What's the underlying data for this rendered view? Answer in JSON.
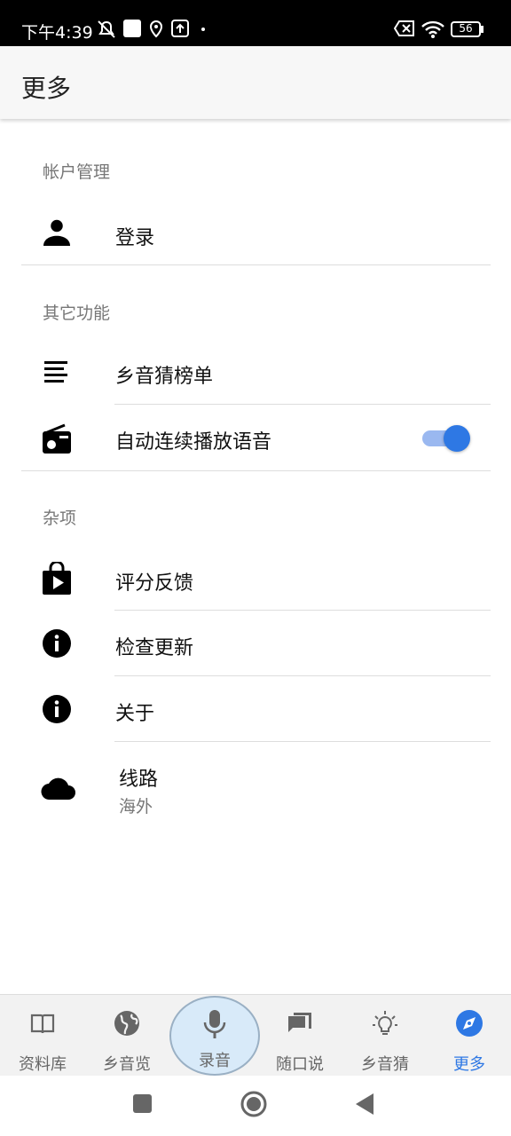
{
  "status_bar": {
    "time": "下午4:39",
    "battery": "56",
    "icons": [
      "mute-icon",
      "square-icon",
      "location-icon",
      "upload-icon",
      "dot-icon",
      "no-sim-icon",
      "wifi-icon",
      "battery-icon"
    ]
  },
  "app_bar": {
    "title": "更多"
  },
  "sections": {
    "account": {
      "label": "帐户管理",
      "items": [
        {
          "label": "登录",
          "icon": "person-icon"
        }
      ]
    },
    "other": {
      "label": "其它功能",
      "items": [
        {
          "label": "乡音猜榜单",
          "icon": "list-icon"
        },
        {
          "label": "自动连续播放语音",
          "icon": "radio-icon",
          "toggle_on": true
        }
      ]
    },
    "misc": {
      "label": "杂项",
      "items": [
        {
          "label": "评分反馈",
          "icon": "play-store-icon"
        },
        {
          "label": "检查更新",
          "icon": "info-icon"
        },
        {
          "label": "关于",
          "icon": "info-icon"
        },
        {
          "label": "线路",
          "sublabel": "海外",
          "icon": "cloud-icon"
        }
      ]
    }
  },
  "bottom_nav": {
    "items": [
      {
        "label": "资料库",
        "icon": "book-icon",
        "active": false
      },
      {
        "label": "乡音览",
        "icon": "globe-icon",
        "active": false
      },
      {
        "label": "录音",
        "icon": "microphone-icon",
        "active": false
      },
      {
        "label": "随口说",
        "icon": "chat-icon",
        "active": false
      },
      {
        "label": "乡音猜",
        "icon": "lightbulb-icon",
        "active": false
      },
      {
        "label": "更多",
        "icon": "compass-icon",
        "active": true
      }
    ]
  },
  "colors": {
    "accent": "#2e78e4",
    "toggle_track": "#9ab8f0",
    "record_bg": "#d8eaf9"
  }
}
